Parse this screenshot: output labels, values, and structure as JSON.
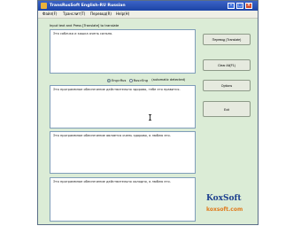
{
  "window": {
    "title": "TransRusSoft English-RU Russian"
  },
  "menubar": [
    {
      "label": "Файл(F)"
    },
    {
      "label": "Транслит(T)"
    },
    {
      "label": "Перевод(R)"
    },
    {
      "label": "Help(H)"
    }
  ],
  "input": {
    "label": "Input text and Press [Translate] to translate",
    "text": "Это собачка и кошка очень сильно."
  },
  "direction": {
    "options": [
      "Eng>Rus",
      "Rus>Eng"
    ],
    "selected": "Eng>Rus",
    "auto_detect": "(automatic detected)"
  },
  "outputs": [
    {
      "text": "Это программное обеспечение действительно здорово, тебе это нравится."
    },
    {
      "text": "Это программное обеспечение является очень здорово, я люблю его."
    },
    {
      "text": "Это программное обеспечение действительно холодно, я люблю его."
    }
  ],
  "buttons": [
    {
      "label": "Перевод (Translate)"
    },
    {
      "label": "Clear All(F1)"
    },
    {
      "label": "Options"
    },
    {
      "label": "Exit"
    }
  ],
  "logo": {
    "main": "KoxSoft",
    "sub": "koxsoft.com"
  },
  "colors": {
    "window_bg": "#dbecd6",
    "title_bar": "#1c44a6",
    "logo_blue": "#1c3f8e",
    "logo_orange": "#e07a1c"
  }
}
